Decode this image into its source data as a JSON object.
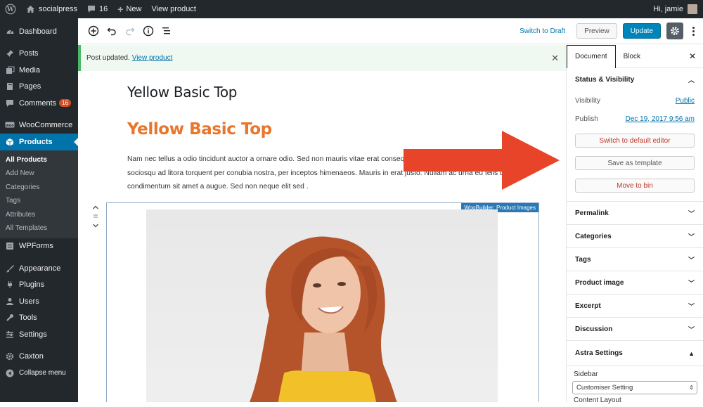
{
  "admin_bar": {
    "site_name": "socialpress",
    "comment_count": "16",
    "new_label": "New",
    "view_product_label": "View product",
    "greeting": "Hi, jamie"
  },
  "side_menu": {
    "dashboard": "Dashboard",
    "posts": "Posts",
    "media": "Media",
    "pages": "Pages",
    "comments": "Comments",
    "comments_badge": "16",
    "woocommerce": "WooCommerce",
    "products": "Products",
    "products_sub": [
      "All Products",
      "Add New",
      "Categories",
      "Tags",
      "Attributes",
      "All Templates"
    ],
    "wpforms": "WPForms",
    "appearance": "Appearance",
    "plugins": "Plugins",
    "users": "Users",
    "tools": "Tools",
    "settings": "Settings",
    "caxton": "Caxton",
    "collapse": "Collapse menu"
  },
  "toolbar": {
    "switch_to_draft": "Switch to Draft",
    "preview": "Preview",
    "update": "Update"
  },
  "notice": {
    "text": "Post updated.",
    "link": "View product"
  },
  "content": {
    "post_title": "Yellow Basic Top",
    "heading": "Yellow Basic Top",
    "paragraph": "Nam nec tellus a odio tincidunt auctor a ornare odio. Sed non mauris vitae erat consequat auctor eu in elit. Class aptent taciti sociosqu ad litora torquent per conubia nostra, per inceptos himenaeos. Mauris in erat justo. Nullam ac urna eu felis dapibus condimentum sit amet a augue. Sed non neque elit sed .",
    "block_label": "WooBuilder: Product Images"
  },
  "sidebar": {
    "tabs": [
      "Document",
      "Block"
    ],
    "status_visibility": "Status & Visibility",
    "visibility_label": "Visibility",
    "visibility_value": "Public",
    "publish_label": "Publish",
    "publish_value": "Dec 19, 2017 9:56 am",
    "switch_editor": "Switch to default editor",
    "save_template": "Save as template",
    "move_to_bin": "Move to bin",
    "panels": [
      "Permalink",
      "Categories",
      "Tags",
      "Product image",
      "Excerpt",
      "Discussion"
    ],
    "astra_settings": "Astra Settings",
    "sidebar_label": "Sidebar",
    "sidebar_select": "Customiser Setting",
    "content_layout": "Content Layout"
  },
  "colors": {
    "accent": "#0073aa",
    "heading_orange": "#e8762d",
    "arrow_red": "#e8442a",
    "admin_dark": "#23282d"
  }
}
